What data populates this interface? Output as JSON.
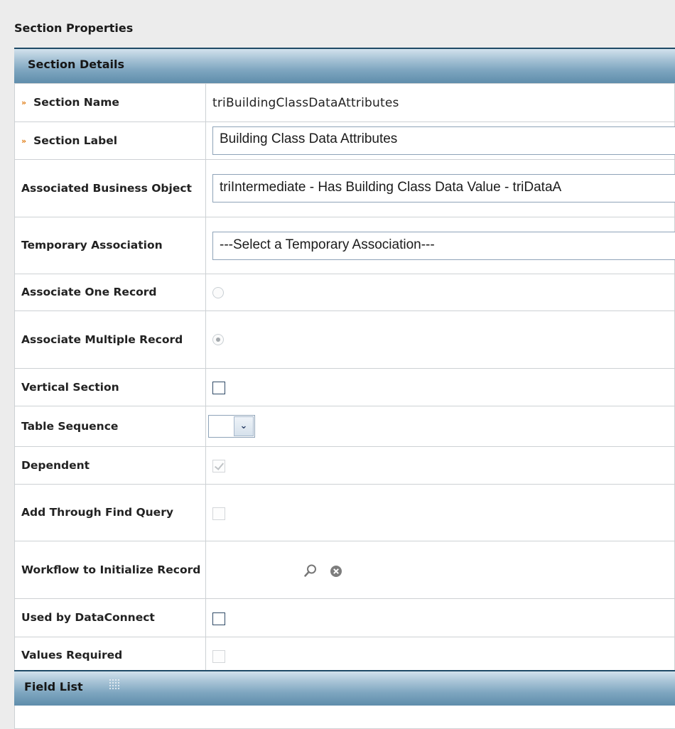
{
  "page": {
    "title": "Section Properties"
  },
  "section_details": {
    "header": "Section Details",
    "rows": [
      {
        "label": "Section Name",
        "required": true,
        "value": "triBuildingClassDataAttributes"
      },
      {
        "label": "Section Label",
        "required": true,
        "value": "Building Class Data Attributes"
      },
      {
        "label": "Associated Business Object",
        "required": false,
        "value": "triIntermediate - Has Building Class Data Value - triDataA"
      },
      {
        "label": "Temporary Association",
        "required": false,
        "value": "---Select a Temporary Association---"
      },
      {
        "label": "Associate One Record",
        "required": false,
        "checked": false
      },
      {
        "label": "Associate Multiple Record",
        "required": false,
        "checked": true
      },
      {
        "label": "Vertical Section",
        "required": false,
        "checked": false
      },
      {
        "label": "Table Sequence",
        "required": false,
        "value": ""
      },
      {
        "label": "Dependent",
        "required": false,
        "checked": true,
        "disabled": true
      },
      {
        "label": "Add Through Find Query",
        "required": false,
        "checked": false,
        "disabled": true
      },
      {
        "label": "Workflow to Initialize Record",
        "required": false,
        "icons": [
          "magnifier-icon",
          "clear-icon"
        ]
      },
      {
        "label": "Used by DataConnect",
        "required": false,
        "checked": false
      },
      {
        "label": "Values Required",
        "required": false,
        "checked": false,
        "disabled": true
      }
    ]
  },
  "field_list": {
    "header": "Field List",
    "icon": "grip-icon"
  },
  "colors": {
    "header_gradient_top": "#d2e2ed",
    "header_gradient_bottom": "#5f8dab",
    "required_marker": "#e07b12",
    "input_border": "#8ea3b8"
  }
}
